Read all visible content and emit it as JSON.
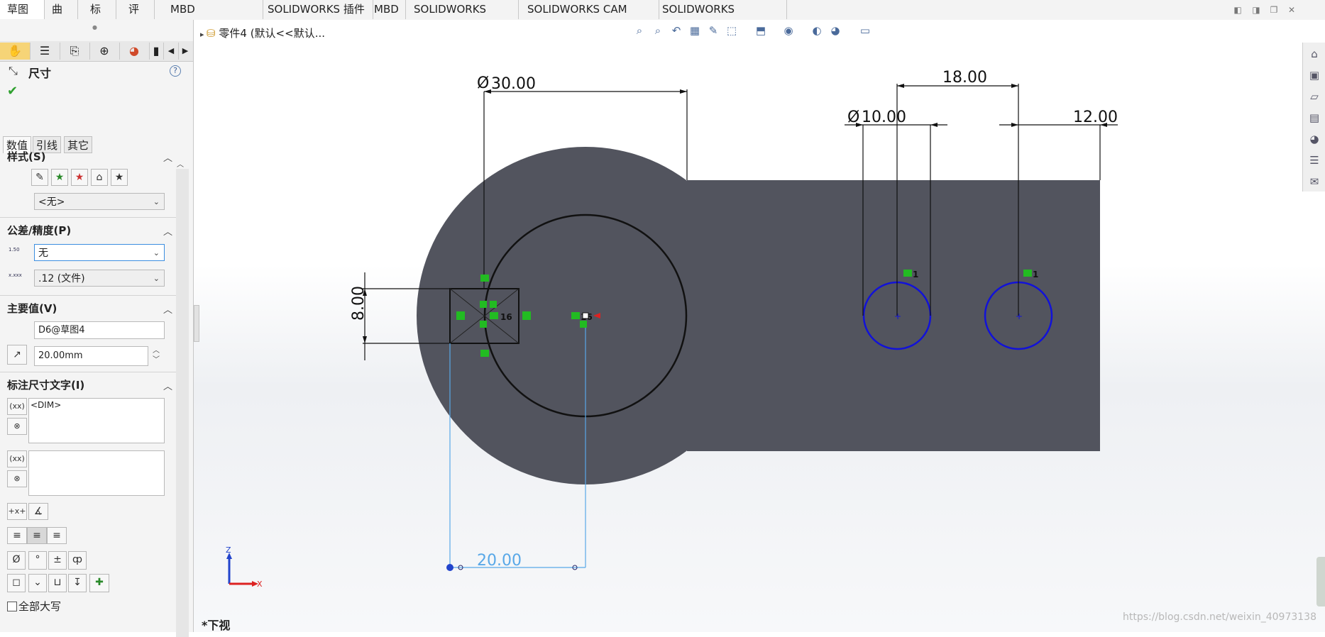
{
  "commandTabs": [
    "草图",
    "曲面",
    "标注",
    "评估",
    "MBD Dimensions",
    "SOLIDWORKS 插件",
    "MBD",
    "SOLIDWORKS CAM",
    "SOLIDWORKS CAM TBM",
    "SOLIDWORKS Inspection"
  ],
  "activeTab": "草图",
  "propertyManager": {
    "title": "尺寸",
    "subTabs": [
      "数值",
      "引线",
      "其它"
    ],
    "style": {
      "title": "样式(S)",
      "selected": "<无>"
    },
    "tolerance": {
      "title": "公差/精度(P)",
      "type": "无",
      "precision": ".12 (文件)",
      "tolIconText": "1.50",
      "precIconText": "x.xxx"
    },
    "primaryValue": {
      "title": "主要值(V)",
      "name": "D6@草图4",
      "value": "20.00mm"
    },
    "dimText": {
      "title": "标注尺寸文字(I)",
      "text": "<DIM>"
    },
    "symbols": [
      "Ø",
      "°",
      "±"
    ],
    "allCaps": "全部大写"
  },
  "breadcrumb": "零件4 (默认<<默认...",
  "viewName": "*下视",
  "watermark": "https://blog.csdn.net/weixin_40973138",
  "sketch": {
    "dimensions": {
      "bigDiameter": "30.00",
      "smallDiameter": "10.00",
      "holeSpacing": "18.00",
      "edgeOffset": "12.00",
      "squareSize": "8.00",
      "selectedDim": "20.00"
    },
    "relationLabels": [
      "1",
      "1",
      "16",
      "16"
    ],
    "triadLabels": [
      "Z",
      "X"
    ]
  },
  "colors": {
    "body": "#52545e",
    "hole": "#1212d8",
    "selected": "#58a8e8",
    "relation": "#22bb22"
  }
}
